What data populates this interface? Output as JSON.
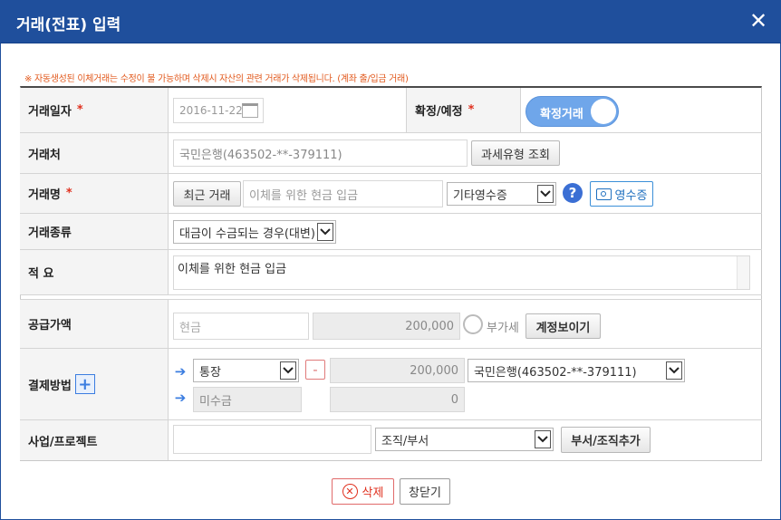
{
  "dialog": {
    "title": "거래(전표) 입력",
    "close_glyph": "✕"
  },
  "notice": "※ 자동생성된 이체거래는 수정이 불 가능하며 삭제시 자산의 관련 거래가 삭제됩니다. (계좌 출/입금 거래)",
  "rows": {
    "date": {
      "label": "거래일자",
      "required": "*",
      "value": "2016-11-22"
    },
    "confirm": {
      "label": "확정/예정",
      "required": "*",
      "toggle_label": "확정거래"
    },
    "partner": {
      "label": "거래처",
      "value": "국민은행(463502-**-379111)",
      "button": "과세유형 조회"
    },
    "name": {
      "label": "거래명",
      "required": "*",
      "recent_button": "최근 거래",
      "value": "이체를 위한 현금 입금",
      "doc_type": "기타영수증",
      "help": "?",
      "receipt_button": "영수증"
    },
    "type": {
      "label": "거래종류",
      "value": "대금이 수금되는 경우(대변)"
    },
    "memo": {
      "label": "적  요",
      "value": "이체를 위한 현금 입금"
    },
    "supply": {
      "label": "공급가액",
      "item": "현금",
      "amount": "200,000",
      "vat_label": "부가세",
      "button": "계정보이기"
    },
    "payment": {
      "label": "결제방법",
      "plus": "+",
      "method": "통장",
      "minus": "-",
      "amount": "200,000",
      "account": "국민은행(463502-**-379111)",
      "unpaid": "미수금",
      "unpaid_amount": "0"
    },
    "project": {
      "label": "사업/프로젝트",
      "value": "",
      "org": "조직/부서",
      "button": "부서/조직추가"
    }
  },
  "footer": {
    "delete": "삭제",
    "close": "창닫기"
  },
  "colors": {
    "title_bar": "#1f4f9c",
    "toggle": "#6fa6ea",
    "accent": "#3b7de0",
    "danger": "#e0301e"
  }
}
